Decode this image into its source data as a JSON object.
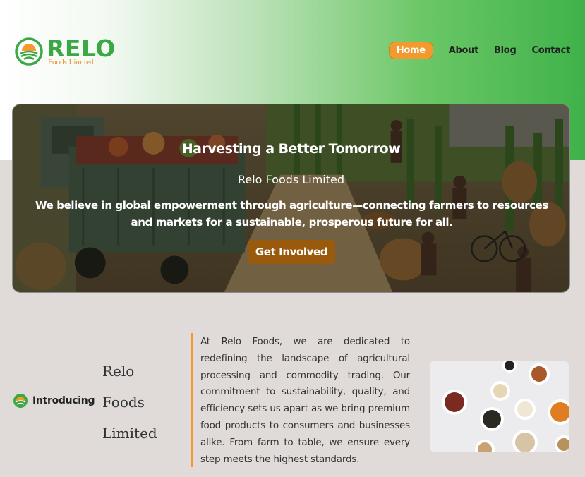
{
  "brand": {
    "name": "RELO",
    "tagline": "Foods Limited"
  },
  "nav": {
    "items": [
      "Home",
      "About",
      "Blog",
      "Contact"
    ],
    "active": "Home"
  },
  "hero": {
    "title": "Harvesting a Better Tomorrow",
    "subtitle": "Relo Foods Limited",
    "text": "We believe in global empowerment through agriculture—connecting farmers to resources and markets for a sustainable, prosperous future for all.",
    "cta": "Get Involved"
  },
  "intro": {
    "badge": "Introducing",
    "name_lines": [
      "Relo",
      "Foods",
      "Limited"
    ],
    "body": "At Relo Foods, we are dedicated to redefining the landscape of agricultural processing and commodity trading. Our commitment to sustainability, quality, and efficiency sets us apart as we bring premium food products to consumers and businesses alike. From farm to table, we ensure every step meets the highest standards."
  },
  "colors": {
    "brand_green": "#3aa845",
    "accent_orange": "#f39a2e",
    "cta_brown": "#9a5a0e",
    "page_bg": "#e0dbd9"
  },
  "icons": [
    "logo-mark",
    "leaf-sun-icon"
  ]
}
